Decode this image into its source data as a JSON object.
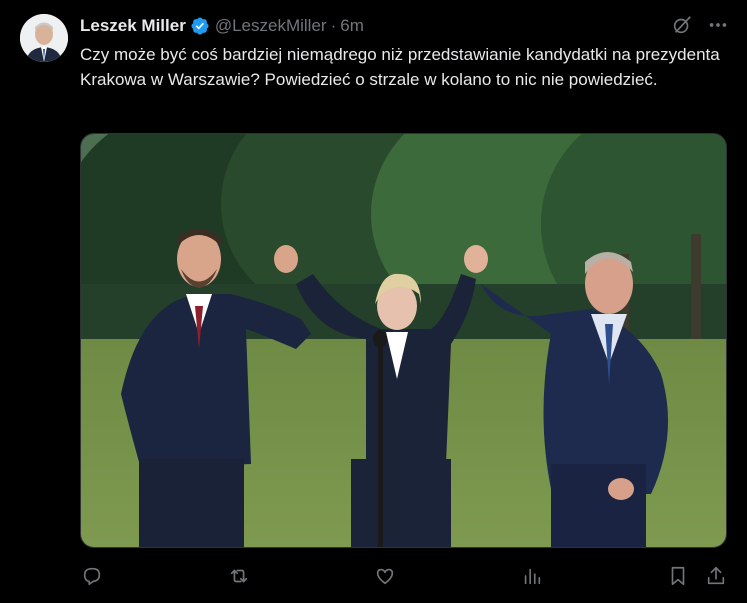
{
  "author": {
    "display_name": "Leszek Miller",
    "handle": "@LeszekMiller",
    "separator": "·",
    "time": "6m",
    "verified": true
  },
  "tweet": {
    "text": "Czy może być coś bardziej niemądrego niż przedstawianie kandydatki na prezydenta Krakowa w Warszawie? Powiedzieć o strzale w kolano to nic nie powiedzieć."
  },
  "icons": {
    "verified": "verified-badge-icon",
    "grok": "grok-icon",
    "more": "more-icon",
    "reply": "reply-icon",
    "repost": "repost-icon",
    "like": "like-icon",
    "views": "views-icon",
    "bookmark": "bookmark-icon",
    "share": "share-icon"
  },
  "colors": {
    "background": "#000000",
    "text": "#e7e9ea",
    "secondary": "#71767b",
    "verified": "#1d9bf0",
    "border": "#2f3336"
  }
}
